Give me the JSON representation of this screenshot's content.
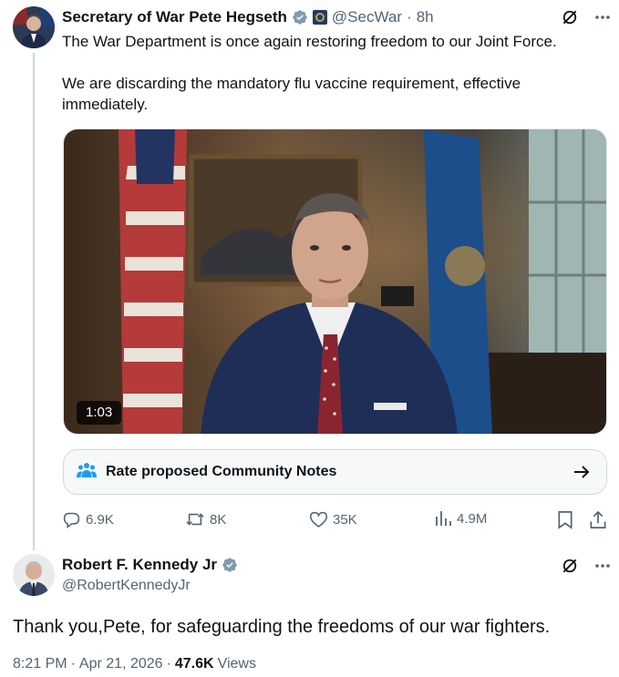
{
  "tweet1": {
    "display_name": "Secretary of War Pete Hegseth",
    "handle": "@SecWar",
    "separator": "·",
    "time": "8h",
    "text_line1": "The War Department is once again restoring freedom to our Joint Force.",
    "text_para2": "We are discarding the mandatory flu vaccine requirement, effective immediately.",
    "video_duration": "1:03",
    "community_notes_label": "Rate proposed Community Notes",
    "actions": {
      "replies": "6.9K",
      "reposts": "8K",
      "likes": "35K",
      "views": "4.9M"
    }
  },
  "tweet2": {
    "display_name": "Robert F. Kennedy Jr",
    "handle": "@RobertKennedyJr",
    "text": "Thank you,Pete, for safeguarding the freedoms of our war fighters.",
    "meta": {
      "time": "8:21 PM",
      "sep1": "·",
      "date": "Apr 21, 2026",
      "sep2": "·",
      "views_count": "47.6K",
      "views_label": "Views"
    }
  },
  "colors": {
    "primary_text": "#0f1419",
    "secondary_text": "#536471",
    "verified_badge": "#829aab",
    "accent_blue": "#1d9bf0",
    "divider": "#cfd9de"
  },
  "icons": {
    "verified": "verified-badge-icon",
    "affiliate": "affiliate-flag-icon",
    "grok": "grok-icon",
    "more": "more-icon",
    "community": "people-icon",
    "arrow": "arrow-right-icon",
    "reply": "reply-icon",
    "repost": "repost-icon",
    "like": "heart-icon",
    "views": "views-icon",
    "bookmark": "bookmark-icon",
    "share": "share-icon"
  }
}
